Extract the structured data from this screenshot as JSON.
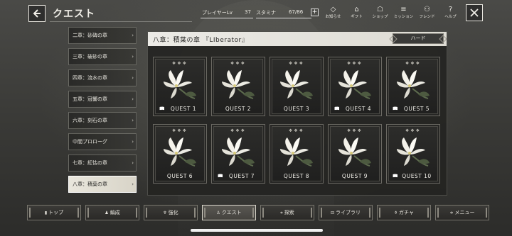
{
  "header": {
    "title": "クエスト",
    "player_lv_label": "プレイヤーLv",
    "player_lv_value": "37",
    "stamina_label": "スタミナ",
    "stamina_value": "67/86",
    "plus_label": "+",
    "icons": [
      {
        "name": "news-icon",
        "glyph": "◇",
        "label": "お知らせ"
      },
      {
        "name": "gift-icon",
        "glyph": "⌂",
        "label": "ギフト"
      },
      {
        "name": "shop-icon",
        "glyph": "☖",
        "label": "ショップ"
      },
      {
        "name": "mission-icon",
        "glyph": "≡",
        "label": "ミッション"
      },
      {
        "name": "friend-icon",
        "glyph": "⚇",
        "label": "フレンド"
      },
      {
        "name": "help-icon",
        "glyph": "?",
        "label": "ヘルプ"
      }
    ]
  },
  "sidebar": {
    "items": [
      {
        "label": "二章：砂碑の章",
        "active": false
      },
      {
        "label": "三章：破砂の章",
        "active": false
      },
      {
        "label": "四章：流水の章",
        "active": false
      },
      {
        "label": "五章：冠響の章",
        "active": false
      },
      {
        "label": "六章：刻石の章",
        "active": false
      },
      {
        "label": "中間プロローグ",
        "active": false
      },
      {
        "label": "七章：紅怙の章",
        "active": false
      },
      {
        "label": "八章：積葉の章",
        "active": true
      }
    ]
  },
  "panel": {
    "title": "八章：積葉の章 『LIberator』",
    "difficulty": "ハード",
    "quests": [
      {
        "label": "QUEST 1",
        "book": true
      },
      {
        "label": "QUEST 2",
        "book": false
      },
      {
        "label": "QUEST 3",
        "book": false
      },
      {
        "label": "QUEST 4",
        "book": true
      },
      {
        "label": "QUEST 5",
        "book": true
      },
      {
        "label": "QUEST 6",
        "book": false
      },
      {
        "label": "QUEST 7",
        "book": true
      },
      {
        "label": "QUEST 8",
        "book": false
      },
      {
        "label": "QUEST 9",
        "book": false
      },
      {
        "label": "QUEST 10",
        "book": true
      }
    ]
  },
  "bottom_nav": {
    "items": [
      {
        "label": "トップ",
        "icon": "▮"
      },
      {
        "label": "編成",
        "icon": "♟"
      },
      {
        "label": "強化",
        "icon": "♆"
      },
      {
        "label": "クエスト",
        "icon": "♙"
      },
      {
        "label": "探索",
        "icon": "⌗"
      },
      {
        "label": "ライブラリ",
        "icon": "⊟"
      },
      {
        "label": "ガチャ",
        "icon": "⚱"
      },
      {
        "label": "メニュー",
        "icon": "≑"
      }
    ],
    "active_index": 3
  }
}
